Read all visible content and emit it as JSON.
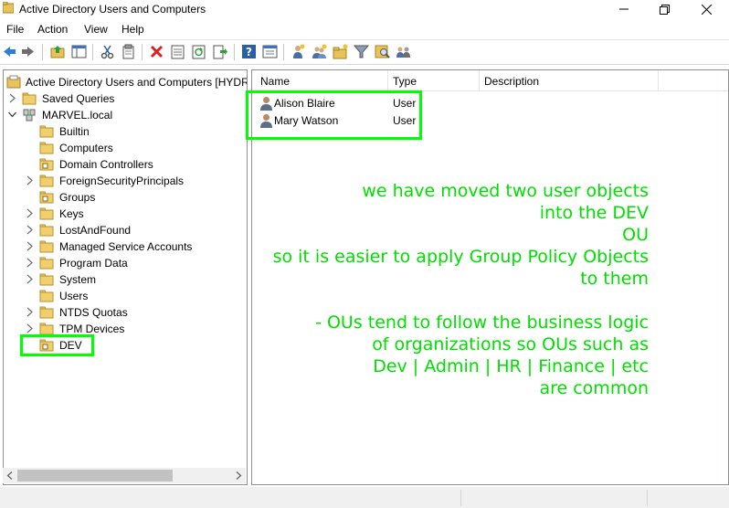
{
  "window": {
    "title": "Active Directory Users and Computers"
  },
  "menu": [
    "File",
    "Action",
    "View",
    "Help"
  ],
  "toolbar": {
    "icons": [
      "back-icon",
      "forward-icon",
      "up-folder-icon",
      "show-hide-console-tree-icon",
      "cut-icon",
      "copy-icon",
      "delete-icon",
      "properties-icon",
      "refresh-icon",
      "export-list-icon",
      "help-icon",
      "view-icon",
      "add-user-icon",
      "add-group-icon",
      "add-ou-icon",
      "filter-icon",
      "find-icon",
      "delegate-icon"
    ]
  },
  "tree": {
    "root": "Active Directory Users and Computers [HYDRA",
    "saved_queries": "Saved Queries",
    "domain": "MARVEL.local",
    "containers": [
      "Builtin",
      "Computers",
      "Domain Controllers",
      "ForeignSecurityPrincipals",
      "Groups",
      "Keys",
      "LostAndFound",
      "Managed Service Accounts",
      "Program Data",
      "System",
      "Users",
      "NTDS Quotas",
      "TPM Devices",
      "DEV"
    ]
  },
  "list": {
    "columns": [
      "Name",
      "Type",
      "Description"
    ],
    "rows": [
      {
        "name": "Alison Blaire",
        "type": "User",
        "description": ""
      },
      {
        "name": "Mary Watson",
        "type": "User",
        "description": ""
      }
    ]
  },
  "annotation": {
    "lines": [
      "we have moved two user objects",
      "into the DEV",
      "OU",
      "so it is easier to apply Group Policy Objects",
      "to them",
      "",
      "- OUs tend to follow the business logic",
      "of organizations so OUs such as",
      "Dev | Admin | HR | Finance | etc",
      "are common"
    ],
    "color": "#00e000",
    "highlight_color": "#00ff00"
  }
}
